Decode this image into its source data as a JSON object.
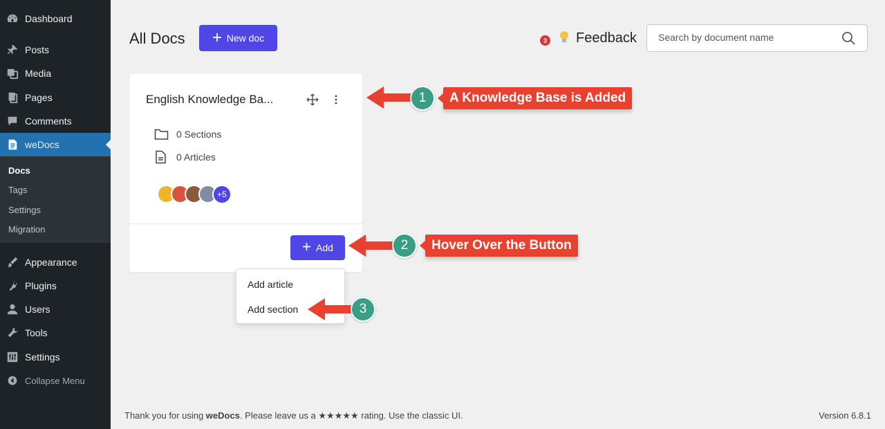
{
  "sidebar": {
    "items": [
      {
        "label": "Dashboard",
        "icon": "dashboard-icon"
      },
      {
        "label": "Posts",
        "icon": "pin-icon"
      },
      {
        "label": "Media",
        "icon": "media-icon"
      },
      {
        "label": "Pages",
        "icon": "pages-icon"
      },
      {
        "label": "Comments",
        "icon": "comment-icon"
      },
      {
        "label": "weDocs",
        "icon": "document-icon"
      },
      {
        "label": "Appearance",
        "icon": "brush-icon"
      },
      {
        "label": "Plugins",
        "icon": "plug-icon"
      },
      {
        "label": "Users",
        "icon": "user-icon"
      },
      {
        "label": "Tools",
        "icon": "wrench-icon"
      },
      {
        "label": "Settings",
        "icon": "sliders-icon"
      }
    ],
    "submenu": [
      "Docs",
      "Tags",
      "Settings",
      "Migration"
    ],
    "collapse_label": "Collapse Menu",
    "colors": {
      "background": "#1d2327",
      "active": "#2271b1",
      "submenu": "#2c3338"
    }
  },
  "header": {
    "title": "All Docs",
    "new_doc_label": "New doc",
    "feedback_count": "3",
    "feedback_label": "Feedback",
    "search_placeholder": "Search by document name",
    "accent": "#4f46e5"
  },
  "card": {
    "title": "English Knowledge Ba...",
    "sections": "0 Sections",
    "articles": "0 Articles",
    "more_contributors": "+5",
    "add_label": "Add"
  },
  "dropdown": {
    "items": [
      "Add article",
      "Add section"
    ]
  },
  "annotations": [
    {
      "number": "1",
      "text": "A Knowledge Base is Added"
    },
    {
      "number": "2",
      "text": "Hover Over the Button"
    },
    {
      "number": "3",
      "text": ""
    }
  ],
  "footer": {
    "prefix": "Thank you for using ",
    "brand": "weDocs",
    "suffix": ". Please leave us a ★★★★★ rating. Use the classic UI.",
    "version": "Version 6.8.1"
  }
}
